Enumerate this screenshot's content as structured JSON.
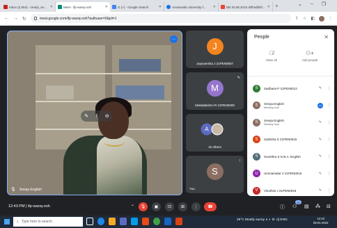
{
  "browser": {
    "tabs": [
      {
        "label": "Inbox (2,554) - sreeja_eng@...",
        "favicon_color": "#c5221f",
        "active": false
      },
      {
        "label": "Meet - ifp-waoq-ooh",
        "favicon_color": "#00897b",
        "active": true
      },
      {
        "label": "G (+) - Google Search",
        "favicon_color": "#4285f4",
        "active": false
      },
      {
        "label": "Annamalai University f...",
        "favicon_color": "#1a73e8",
        "active": false
      },
      {
        "label": "DB 20.08.2015 dsfhsdfdsf...",
        "favicon_color": "#ea4335",
        "active": false
      }
    ],
    "new_tab": "+",
    "url": "meet.google.com/ifp-waoq-ooh?authuser=0&pli=1"
  },
  "main_video": {
    "speaker_name": "Sreeja English"
  },
  "tiles": [
    {
      "initial": "J",
      "name": "Jayavarnika J 21PEN0007",
      "avatar_color": "#f4841e"
    },
    {
      "initial": "M",
      "name": "Mahalakshmi R 21PEN0009",
      "avatar_color": "#9575cd"
    },
    {
      "initial": "A",
      "name": "16 others",
      "avatar_color": "#5c6bc0"
    },
    {
      "initial": "S",
      "name": "You",
      "avatar_color": "#8d6e63"
    }
  ],
  "people_panel": {
    "title": "People",
    "close_glyph": "✕",
    "actions": [
      {
        "label": "Mute all"
      },
      {
        "label": "Add people"
      }
    ],
    "participants": [
      {
        "initial": "S",
        "name": "Sadhana P 21PEN0012",
        "sub": "",
        "avatar_color": "#2e7d32",
        "speaking": false
      },
      {
        "initial": "S",
        "name": "Sreeja English",
        "sub": "Meeting host",
        "avatar_color": "#8d6e63",
        "speaking": true
      },
      {
        "initial": "S",
        "name": "Sreeja English",
        "sub": "Meeting host",
        "avatar_color": "#8d6e63",
        "speaking": false
      },
      {
        "initial": "S",
        "name": "Subitsha S 21PEN0015",
        "sub": "",
        "avatar_color": "#d84315",
        "speaking": false
      },
      {
        "initial": "S",
        "name": "Sunethra S N B.A. English",
        "sub": "",
        "avatar_color": "#546e7a",
        "speaking": false
      },
      {
        "initial": "U",
        "name": "Ummamalar V 21PEN0016",
        "sub": "",
        "avatar_color": "#8e24aa",
        "speaking": false
      },
      {
        "initial": "V",
        "name": "Vinothini J 21PEN0018",
        "sub": "",
        "avatar_color": "#c62828",
        "speaking": false
      }
    ]
  },
  "bottom_bar": {
    "time_meeting": "12:43 PM | ifp-waoq-ooh",
    "people_count": "26"
  },
  "taskbar": {
    "search_placeholder": "Type here to search",
    "tray_text": "29°C  Mostly sunny  ∧  ◐  ⊡  ◁)  ENG",
    "clock_time": "12:43",
    "clock_date": "05-01-2022"
  }
}
